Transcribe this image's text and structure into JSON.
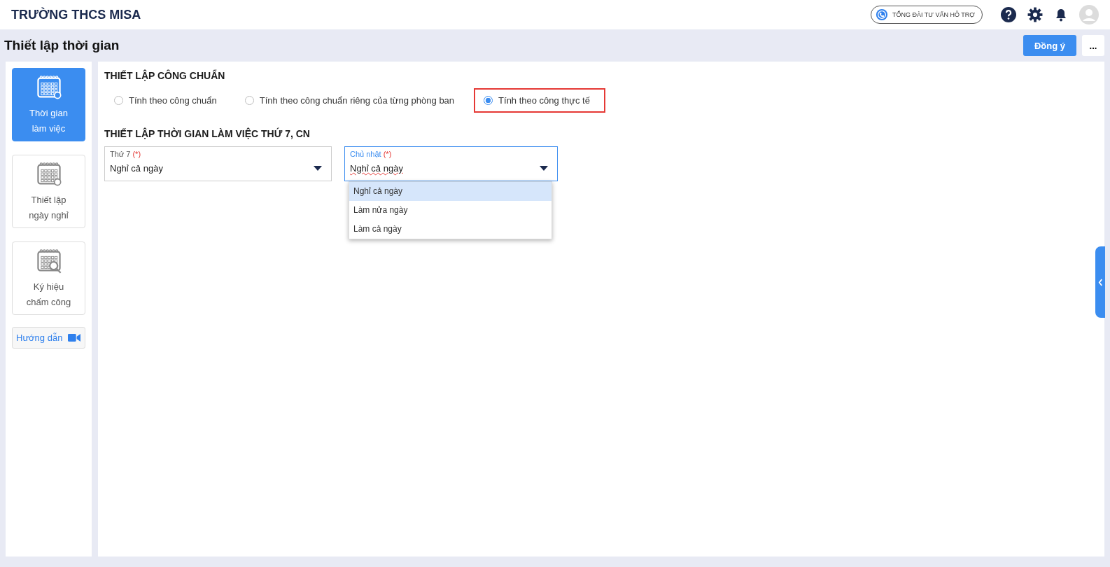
{
  "header": {
    "title": "TRƯỜNG THCS MISA",
    "support_label": "TỔNG ĐÀI TƯ VẤN HỖ TRỢ"
  },
  "page": {
    "title": "Thiết lập thời gian",
    "primary_button": "Đồng ý",
    "more_button": "..."
  },
  "sidebar": {
    "items": [
      {
        "label": "Thời gian làm việc",
        "kind": "calendar",
        "selected": true
      },
      {
        "label": "Thiết lập ngày nghỉ",
        "kind": "calendar",
        "selected": false
      },
      {
        "label": "Ký hiệu chấm công",
        "kind": "search",
        "selected": false
      }
    ],
    "guide_button": "Hướng dẫn"
  },
  "sections": [
    {
      "kind": "radios",
      "title": "THIẾT LẬP CÔNG CHUẨN",
      "options": [
        {
          "label": "Tính theo công chuẩn",
          "selected": false,
          "highlighted": false
        },
        {
          "label": "Tính theo công chuẩn riêng của từng phòng ban",
          "selected": false,
          "highlighted": false
        },
        {
          "label": "Tính theo công thực tế",
          "selected": true,
          "highlighted": true
        }
      ]
    },
    {
      "kind": "fields",
      "title": "THIẾT LẬP THỜI GIAN LÀM VIỆC THỨ 7, CN",
      "fields": [
        {
          "label": "Thứ 7",
          "required_mark": "(*)",
          "value": "Nghỉ cả ngày",
          "focused": false
        },
        {
          "label": "Chủ nhật",
          "required_mark": "(*)",
          "value": "Nghỉ cả ngày",
          "focused": true,
          "expanded": true,
          "options": [
            {
              "label": "Nghỉ cả ngày",
              "selected": true
            },
            {
              "label": "Làm nửa ngày",
              "selected": false
            },
            {
              "label": "Làm cả ngày",
              "selected": false
            }
          ]
        }
      ]
    }
  ]
}
